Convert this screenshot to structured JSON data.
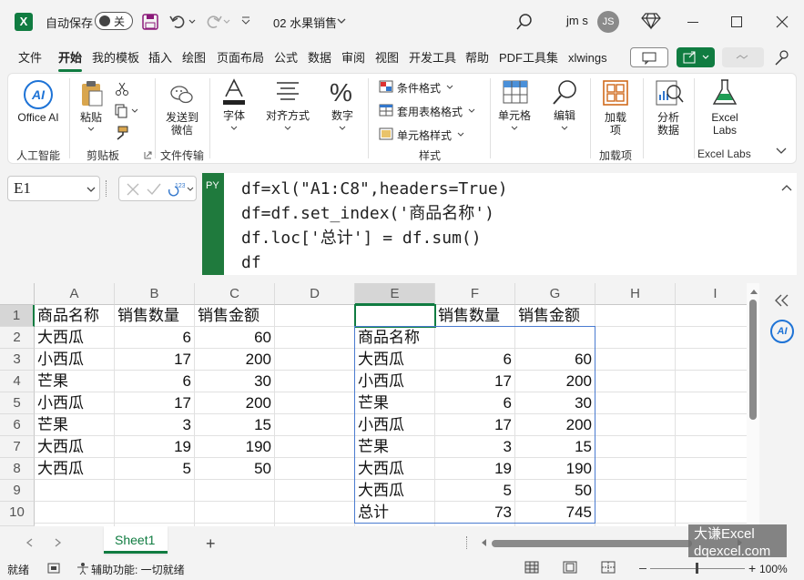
{
  "titlebar": {
    "autosave_label": "自动保存",
    "autosave_state": "关",
    "filename": "02 水果销售",
    "user_name": "jm s",
    "user_initials": "JS"
  },
  "menu": {
    "tabs": [
      "文件",
      "开始",
      "我的模板",
      "插入",
      "绘图",
      "页面布局",
      "公式",
      "数据",
      "审阅",
      "视图",
      "开发工具",
      "帮助",
      "PDF工具集",
      "xlwings"
    ],
    "active_tab": "开始"
  },
  "ribbon": {
    "office_ai": "Office AI",
    "paste": "粘贴",
    "send_wechat": "发送到微信",
    "font": "字体",
    "align": "对齐方式",
    "number": "数字",
    "cond_format": "条件格式",
    "table_format": "套用表格格式",
    "cell_style": "单元格样式",
    "cells": "单元格",
    "edit": "编辑",
    "addins": "加载项",
    "analyze": "分析数据",
    "excel_labs": "Excel Labs",
    "group_ai": "人工智能",
    "group_clipboard": "剪贴板",
    "group_transfer": "文件传输",
    "group_styles": "样式",
    "group_addins": "加载项",
    "group_labs": "Excel Labs"
  },
  "formula": {
    "namebox": "E1",
    "py_badge": "PY",
    "lines": [
      "df=xl(\"A1:C8\",headers=True)",
      "df=df.set_index('商品名称')",
      "df.loc['总计'] = df.sum()",
      "df"
    ]
  },
  "columns": [
    "A",
    "B",
    "C",
    "D",
    "E",
    "F",
    "G",
    "H",
    "I"
  ],
  "rows": [
    "1",
    "2",
    "3",
    "4",
    "5",
    "6",
    "7",
    "8",
    "9",
    "10"
  ],
  "table1": {
    "headers": [
      "商品名称",
      "销售数量",
      "销售金额"
    ],
    "rows": [
      [
        "大西瓜",
        "6",
        "60"
      ],
      [
        "小西瓜",
        "17",
        "200"
      ],
      [
        "芒果",
        "6",
        "30"
      ],
      [
        "小西瓜",
        "17",
        "200"
      ],
      [
        "芒果",
        "3",
        "15"
      ],
      [
        "大西瓜",
        "19",
        "190"
      ],
      [
        "大西瓜",
        "5",
        "50"
      ]
    ]
  },
  "table2": {
    "headers": [
      "",
      "销售数量",
      "销售金额"
    ],
    "index_name": "商品名称",
    "rows": [
      [
        "大西瓜",
        "6",
        "60"
      ],
      [
        "小西瓜",
        "17",
        "200"
      ],
      [
        "芒果",
        "6",
        "30"
      ],
      [
        "小西瓜",
        "17",
        "200"
      ],
      [
        "芒果",
        "3",
        "15"
      ],
      [
        "大西瓜",
        "19",
        "190"
      ],
      [
        "大西瓜",
        "5",
        "50"
      ],
      [
        "总计",
        "73",
        "745"
      ]
    ]
  },
  "sheet": {
    "tab": "Sheet1"
  },
  "status": {
    "ready": "就绪",
    "accessibility": "辅助功能: 一切就绪",
    "zoom": "100%"
  },
  "watermark": {
    "line1": "大谦Excel",
    "line2": "dqexcel.com"
  },
  "colors": {
    "accent": "#107c41",
    "py_green": "#1f7a3d"
  }
}
